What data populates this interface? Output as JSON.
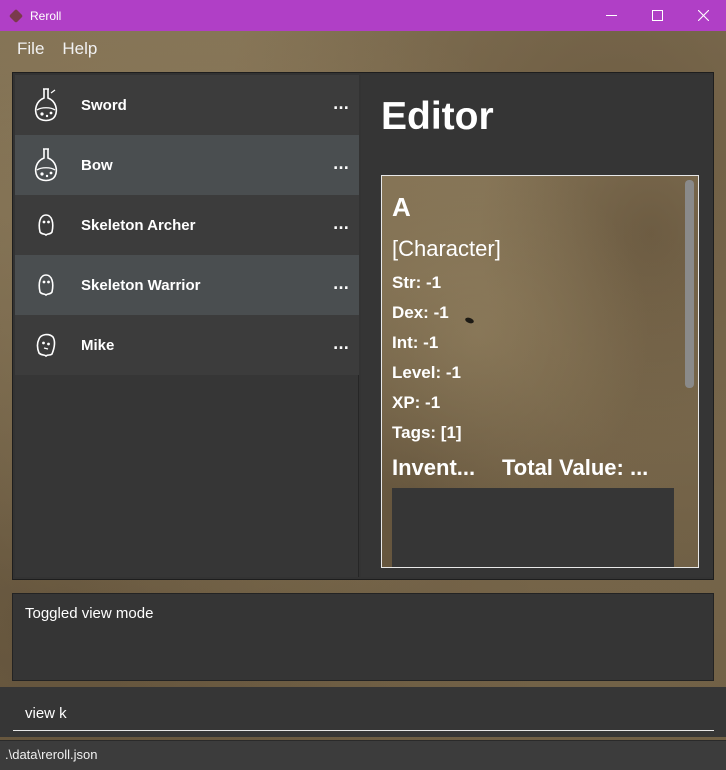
{
  "window": {
    "title": "Reroll",
    "minimize_icon": "minimize-icon",
    "maximize_icon": "maximize-icon",
    "close_icon": "close-icon",
    "accent_color": "#b03fc6"
  },
  "menu": {
    "items": [
      {
        "label": "File"
      },
      {
        "label": "Help"
      }
    ]
  },
  "entity_list": {
    "items": [
      {
        "name": "Sword",
        "icon": "potion-icon",
        "menu": "..."
      },
      {
        "name": "Bow",
        "icon": "potion-icon",
        "menu": "..."
      },
      {
        "name": "Skeleton Archer",
        "icon": "ghost-icon",
        "menu": "..."
      },
      {
        "name": "Skeleton Warrior",
        "icon": "ghost-icon",
        "menu": "..."
      },
      {
        "name": "Mike",
        "icon": "ghost-icon",
        "menu": "..."
      }
    ]
  },
  "editor": {
    "title": "Editor",
    "card": {
      "name": "A",
      "type": "[Character]",
      "str": "Str: -1",
      "dex": "Dex: -1",
      "int": "Int: -1",
      "level": "Level: -1",
      "xp": "XP: -1",
      "tags": "Tags: [1]",
      "inventory_header": "Invent...",
      "total_value_header": "Total Value: ..."
    }
  },
  "result": {
    "text": "Toggled view mode"
  },
  "command": {
    "value": "view k"
  },
  "status": {
    "path": ".\\data\\reroll.json"
  }
}
